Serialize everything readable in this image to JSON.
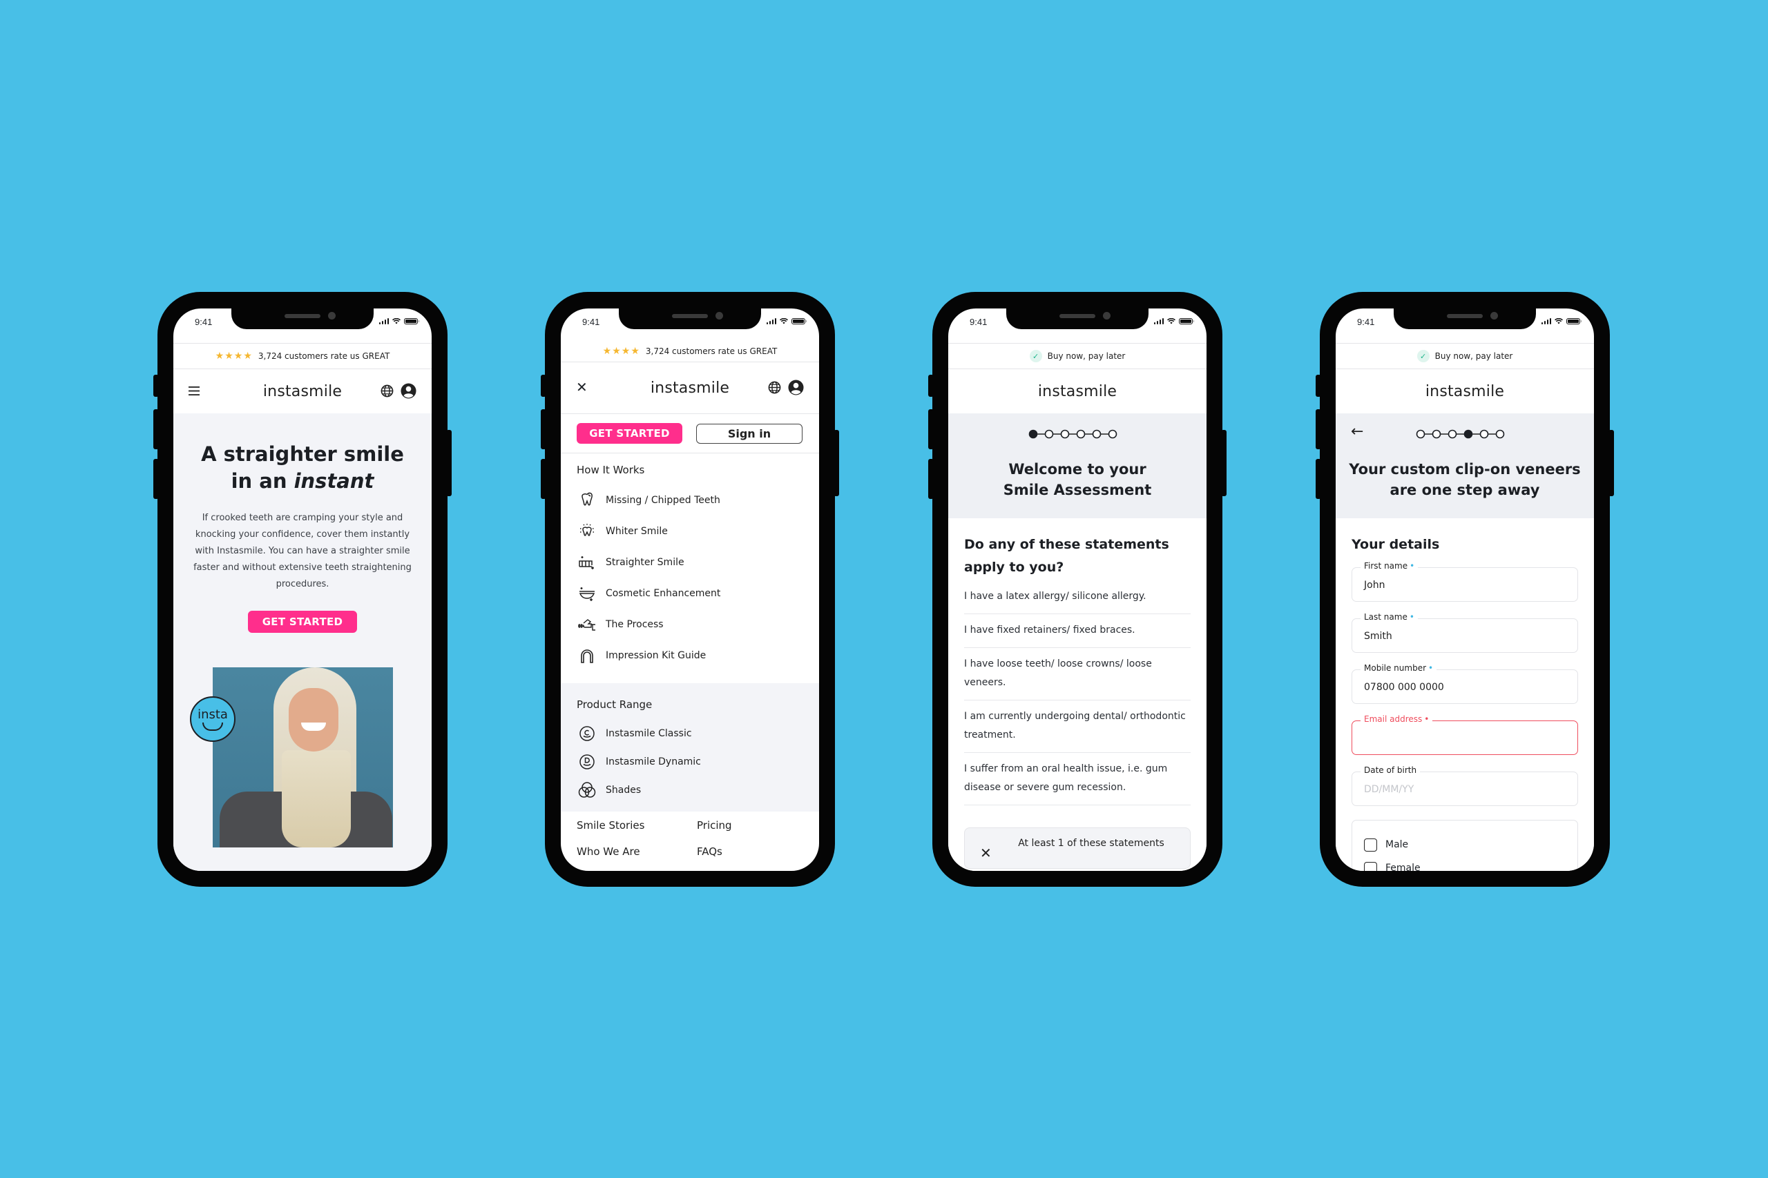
{
  "background_color": "#48bfe7",
  "brand": {
    "name": "instasmile",
    "accent": "#ff2e8c",
    "error": "#ef4d5d",
    "required_dot": "#3fb7e3",
    "star": "#f5b731"
  },
  "status_bar": {
    "time": "9:41"
  },
  "phones": [
    {
      "screen": "home",
      "topbar": {
        "stars": "★★★★",
        "text": "3,724 customers rate us GREAT"
      },
      "header": {
        "logo": "instasmile",
        "left_icon": "hamburger-icon",
        "right_icons": [
          "globe-icon",
          "account-icon"
        ]
      },
      "hero": {
        "title_line1": "A straighter smile",
        "title_line2_prefix": "in an ",
        "title_line2_emph": "instant",
        "body": "If crooked teeth are cramping your style and knocking your confidence, cover them instantly with Instasmile. You can have a straighter smile faster and without extensive teeth straightening procedures.",
        "cta": "GET STARTED",
        "badge": "insta"
      }
    },
    {
      "screen": "menu",
      "topbar": {
        "stars": "★★★★",
        "text": "3,724 customers rate us GREAT"
      },
      "header": {
        "logo": "instasmile",
        "left_icon": "close-icon",
        "right_icons": [
          "globe-icon",
          "account-icon"
        ]
      },
      "cta": {
        "get_started": "GET STARTED",
        "sign_in": "Sign in"
      },
      "how_it_works": {
        "heading": "How It Works",
        "items": [
          {
            "label": "Missing / Chipped Teeth",
            "icon": "chipped-tooth-icon"
          },
          {
            "label": "Whiter Smile",
            "icon": "sparkling-tooth-icon"
          },
          {
            "label": "Straighter Smile",
            "icon": "straight-teeth-icon"
          },
          {
            "label": "Cosmetic Enhancement",
            "icon": "veneer-tray-icon"
          },
          {
            "label": "The Process",
            "icon": "hand-kit-icon"
          },
          {
            "label": "Impression Kit Guide",
            "icon": "impression-arch-icon"
          }
        ]
      },
      "product_range": {
        "heading": "Product Range",
        "items": [
          {
            "label": "Instasmile Classic",
            "icon": "classic-c-icon"
          },
          {
            "label": "Instasmile Dynamic",
            "icon": "dynamic-d-icon"
          },
          {
            "label": "Shades",
            "icon": "shades-circles-icon"
          }
        ]
      },
      "links": [
        "Smile Stories",
        "Pricing",
        "Who We Are",
        "FAQs"
      ]
    },
    {
      "screen": "assessment-welcome",
      "topbar": {
        "text": "Buy now, pay later"
      },
      "header": {
        "logo": "instasmile"
      },
      "stepper": {
        "total": 6,
        "current": 1
      },
      "title_line1": "Welcome to your",
      "title_line2": "Smile Assessment",
      "question": "Do any of these statements apply to you?",
      "statements": [
        "I have a latex allergy/ silicone allergy.",
        "I have fixed retainers/ fixed braces.",
        "I have loose teeth/ loose crowns/ loose veneers.",
        "I am currently undergoing dental/ orthodontic treatment.",
        "I suffer from an oral health issue, i.e. gum disease or severe gum recession."
      ],
      "answer_option": {
        "icon": "close-icon",
        "text": "At least 1 of these statements"
      }
    },
    {
      "screen": "your-details",
      "topbar": {
        "text": "Buy now, pay later"
      },
      "header": {
        "logo": "instasmile"
      },
      "stepper": {
        "total": 6,
        "current": 4
      },
      "title_line1": "Your custom clip-on veneers",
      "title_line2": "are one step away",
      "section": "Your details",
      "fields": [
        {
          "label": "First name",
          "required": true,
          "value": "John",
          "placeholder": "",
          "error": false
        },
        {
          "label": "Last name",
          "required": true,
          "value": "Smith",
          "placeholder": "",
          "error": false
        },
        {
          "label": "Mobile number",
          "required": true,
          "value": "07800 000 0000",
          "placeholder": "",
          "error": false
        },
        {
          "label": "Email address",
          "required": true,
          "value": "",
          "placeholder": "",
          "error": true
        },
        {
          "label": "Date of birth",
          "required": false,
          "value": "",
          "placeholder": "DD/MM/YY",
          "error": false
        }
      ],
      "gender_options": [
        {
          "label": "Male",
          "checked": false
        },
        {
          "label": "Female",
          "checked": false
        }
      ]
    }
  ]
}
